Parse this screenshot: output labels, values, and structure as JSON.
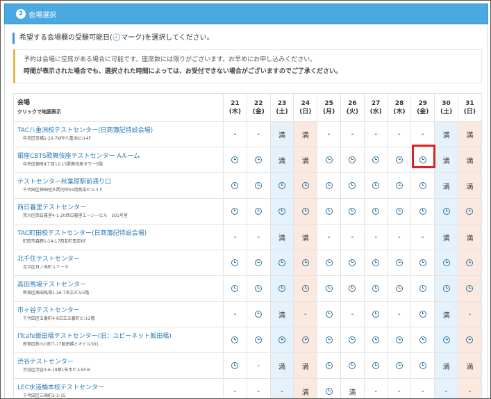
{
  "header": {
    "step": "2",
    "title": "会場選択"
  },
  "instruction": "希望する会場欄の受験可能日(🕘マーク)を選択してください。",
  "notice": {
    "line1": "予約は会場に空席がある場合に可能です。座席数には限りがございます。お早めにお申し込みください。",
    "line2": "時間が表示された場合でも、選択された時間によっては、お受付できない場合がございますのでご了承ください。"
  },
  "table": {
    "venue_header": "会場",
    "venue_subheader": "クリックで地図表示",
    "dates": [
      {
        "day": "21",
        "weekday": "(木)",
        "type": ""
      },
      {
        "day": "22",
        "weekday": "(金)",
        "type": ""
      },
      {
        "day": "23",
        "weekday": "(土)",
        "type": "sat"
      },
      {
        "day": "24",
        "weekday": "(日)",
        "type": "sun"
      },
      {
        "day": "25",
        "weekday": "(月)",
        "type": ""
      },
      {
        "day": "26",
        "weekday": "(火)",
        "type": ""
      },
      {
        "day": "27",
        "weekday": "(水)",
        "type": ""
      },
      {
        "day": "28",
        "weekday": "(木)",
        "type": ""
      },
      {
        "day": "29",
        "weekday": "(金)",
        "type": ""
      },
      {
        "day": "30",
        "weekday": "(土)",
        "type": "sat"
      },
      {
        "day": "31",
        "weekday": "(日)",
        "type": "sun"
      }
    ],
    "legend": {
      "available": "clock-icon",
      "full": "満",
      "none": "-"
    },
    "rows": [
      {
        "name": "TAC八重洲校テストセンター(日商簿記特設会場)",
        "address": "中央区京橋1-10-7KPP八重洲ビル4F",
        "cells": [
          "-",
          "-",
          "満",
          "満",
          "-",
          "-",
          "-",
          "-",
          "-",
          "満",
          "満"
        ]
      },
      {
        "name": "銀座CBTS歌舞伎座テストセンター Aルーム",
        "address": "中央区銀座4丁目12-15歌舞伎座タワー5階",
        "cells": [
          "o",
          "o",
          "満",
          "満",
          "o",
          "o",
          "o",
          "o",
          "o",
          "満",
          "満"
        ]
      },
      {
        "name": "テストセンター秋葉原駅前通り口",
        "address": "千代田区神田佐久間河岸55焼鳥染ビル３Ｆ",
        "cells": [
          "o",
          "o",
          "o",
          "o",
          "o",
          "o",
          "o",
          "o",
          "o",
          "満",
          "満"
        ]
      },
      {
        "name": "西日暮里テストセンター",
        "address": "荒川区西日暮里4-1-20西日暮里エーシービル　501号室",
        "cells": [
          "o",
          "o",
          "o",
          "o",
          "o",
          "o",
          "o",
          "o",
          "o",
          "o",
          "o"
        ]
      },
      {
        "name": "TAC町田校テストセンター(日商簿記特設会場)",
        "address": "町田市森野1-14-17西友町田店6F",
        "cells": [
          "-",
          "-",
          "満",
          "満",
          "-",
          "-",
          "-",
          "-",
          "-",
          "満",
          "満"
        ]
      },
      {
        "name": "北千住テストセンター",
        "address": "足立区日ノ出町１７－９",
        "cells": [
          "o",
          "o",
          "o",
          "o",
          "o",
          "o",
          "o",
          "o",
          "o",
          "o",
          "o"
        ]
      },
      {
        "name": "高田馬場テストセンター",
        "address": "新宿区高田馬場1-26-7名古ビル5階",
        "cells": [
          "o",
          "o",
          "o",
          "o",
          "o",
          "o",
          "o",
          "o",
          "o",
          "o",
          "o"
        ]
      },
      {
        "name": "市ヶ谷テストセンター",
        "address": "千代田区五番町4-8日立五番町ビル2階",
        "cells": [
          "-",
          "o",
          "満",
          "-",
          "o",
          "-",
          "o",
          "-",
          "o",
          "満",
          "-"
        ]
      },
      {
        "name": "ITcafe飯田橋テストセンター(旧：ユビーネット飯田橋)",
        "address": "新宿区新小川町7-17飯田橋ミキビル301",
        "cells": [
          "o",
          "o",
          "o",
          "o",
          "o",
          "o",
          "o",
          "o",
          "o",
          "o",
          "o"
        ]
      },
      {
        "name": "渋谷テストセンター",
        "address": "渋谷区渋谷3-6-19第1矢木ビル5F-B",
        "cells": [
          "o",
          "-",
          "満",
          "満",
          "o",
          "o",
          "o",
          "o",
          "o",
          "満",
          "満"
        ]
      },
      {
        "name": "LEC水道橋本校テストセンター",
        "address": "千代田区三崎町2-2-15",
        "cells": [
          "-",
          "-",
          "-",
          "満",
          "o",
          "満",
          "-",
          "-",
          "-",
          "-",
          "-"
        ]
      }
    ]
  },
  "selection": {
    "row": 1,
    "column": "29"
  }
}
